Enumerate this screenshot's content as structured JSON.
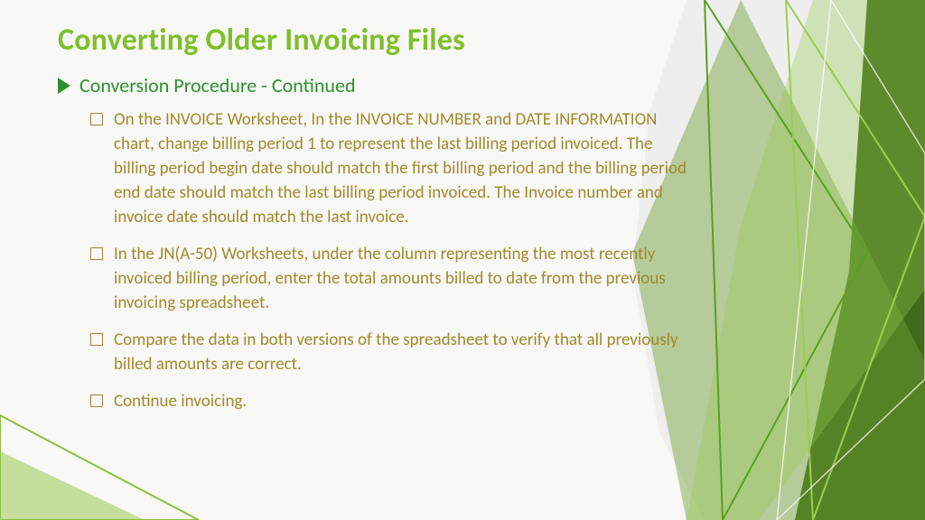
{
  "title": "Converting Older Invoicing Files",
  "subhead": "Conversion Procedure - Continued",
  "items": [
    "On the INVOICE Worksheet, In the INVOICE NUMBER and DATE INFORMATION chart, change billing period 1 to represent the last billing period invoiced. The billing period begin date should match the first billing period and the billing period end date should match the last billing period invoiced. The Invoice number and invoice date should match the last invoice.",
    "In the JN(A-50) Worksheets, under the column representing the most recently invoiced billing period, enter the total amounts billed to date from the previous invoicing spreadsheet.",
    "Compare the data in both versions of the spreadsheet to verify that all previously billed amounts are correct.",
    "Continue invoicing."
  ]
}
